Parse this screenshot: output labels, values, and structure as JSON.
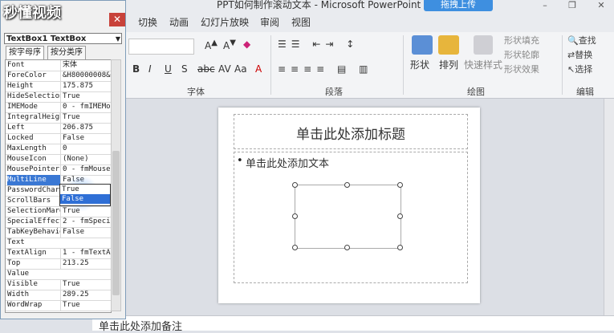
{
  "window": {
    "title": "PPT如何制作滚动文本 - Microsoft PowerPoint",
    "upload_button": "拖拽上传",
    "minimize_icon": "–",
    "restore_icon": "❐",
    "close_icon": "✕"
  },
  "logo": "秒懂视频",
  "ribbon": {
    "tabs": [
      "切换",
      "动画",
      "幻灯片放映",
      "审阅",
      "视图"
    ],
    "groups": {
      "font": "字体",
      "paragraph": "段落",
      "drawing": "绘图",
      "editing": "编辑"
    },
    "drawing_buttons": {
      "shapes": "形状",
      "arrange": "排列",
      "quick_styles": "快速样式"
    },
    "shape_options": {
      "fill": "形状填充",
      "outline": "形状轮廓",
      "effects": "形状效果"
    },
    "editing": {
      "find": "查找",
      "replace": "替换",
      "select": "选择"
    }
  },
  "slide": {
    "title_placeholder": "单击此处添加标题",
    "body_placeholder": "单击此处添加文本",
    "notes_placeholder": "单击此处添加备注"
  },
  "properties": {
    "object": "TextBox1 TextBox",
    "tab_alpha": "按字母序",
    "tab_category": "按分类序",
    "rows": [
      {
        "name": "Font",
        "value": "宋体"
      },
      {
        "name": "ForeColor",
        "value": "&H80000008&"
      },
      {
        "name": "Height",
        "value": "175.875"
      },
      {
        "name": "HideSelection",
        "value": "True"
      },
      {
        "name": "IMEMode",
        "value": "0 - fmIMEMode"
      },
      {
        "name": "IntegralHeight",
        "value": "True"
      },
      {
        "name": "Left",
        "value": "206.875"
      },
      {
        "name": "Locked",
        "value": "False"
      },
      {
        "name": "MaxLength",
        "value": "0"
      },
      {
        "name": "MouseIcon",
        "value": "(None)"
      },
      {
        "name": "MousePointer",
        "value": "0 - fmMouse"
      },
      {
        "name": "MultiLine",
        "value": "False"
      },
      {
        "name": "PasswordChar",
        "value": ""
      },
      {
        "name": "ScrollBars",
        "value": ""
      },
      {
        "name": "SelectionMargin",
        "value": "True"
      },
      {
        "name": "SpecialEffect",
        "value": "2 - fmSpecial"
      },
      {
        "name": "TabKeyBehavior",
        "value": "False"
      },
      {
        "name": "Text",
        "value": ""
      },
      {
        "name": "TextAlign",
        "value": "1 - fmTextA"
      },
      {
        "name": "Top",
        "value": "213.25"
      },
      {
        "name": "Value",
        "value": ""
      },
      {
        "name": "Visible",
        "value": "True"
      },
      {
        "name": "Width",
        "value": "289.25"
      },
      {
        "name": "WordWrap",
        "value": "True"
      }
    ],
    "dropdown_options": [
      "True",
      "False"
    ]
  }
}
